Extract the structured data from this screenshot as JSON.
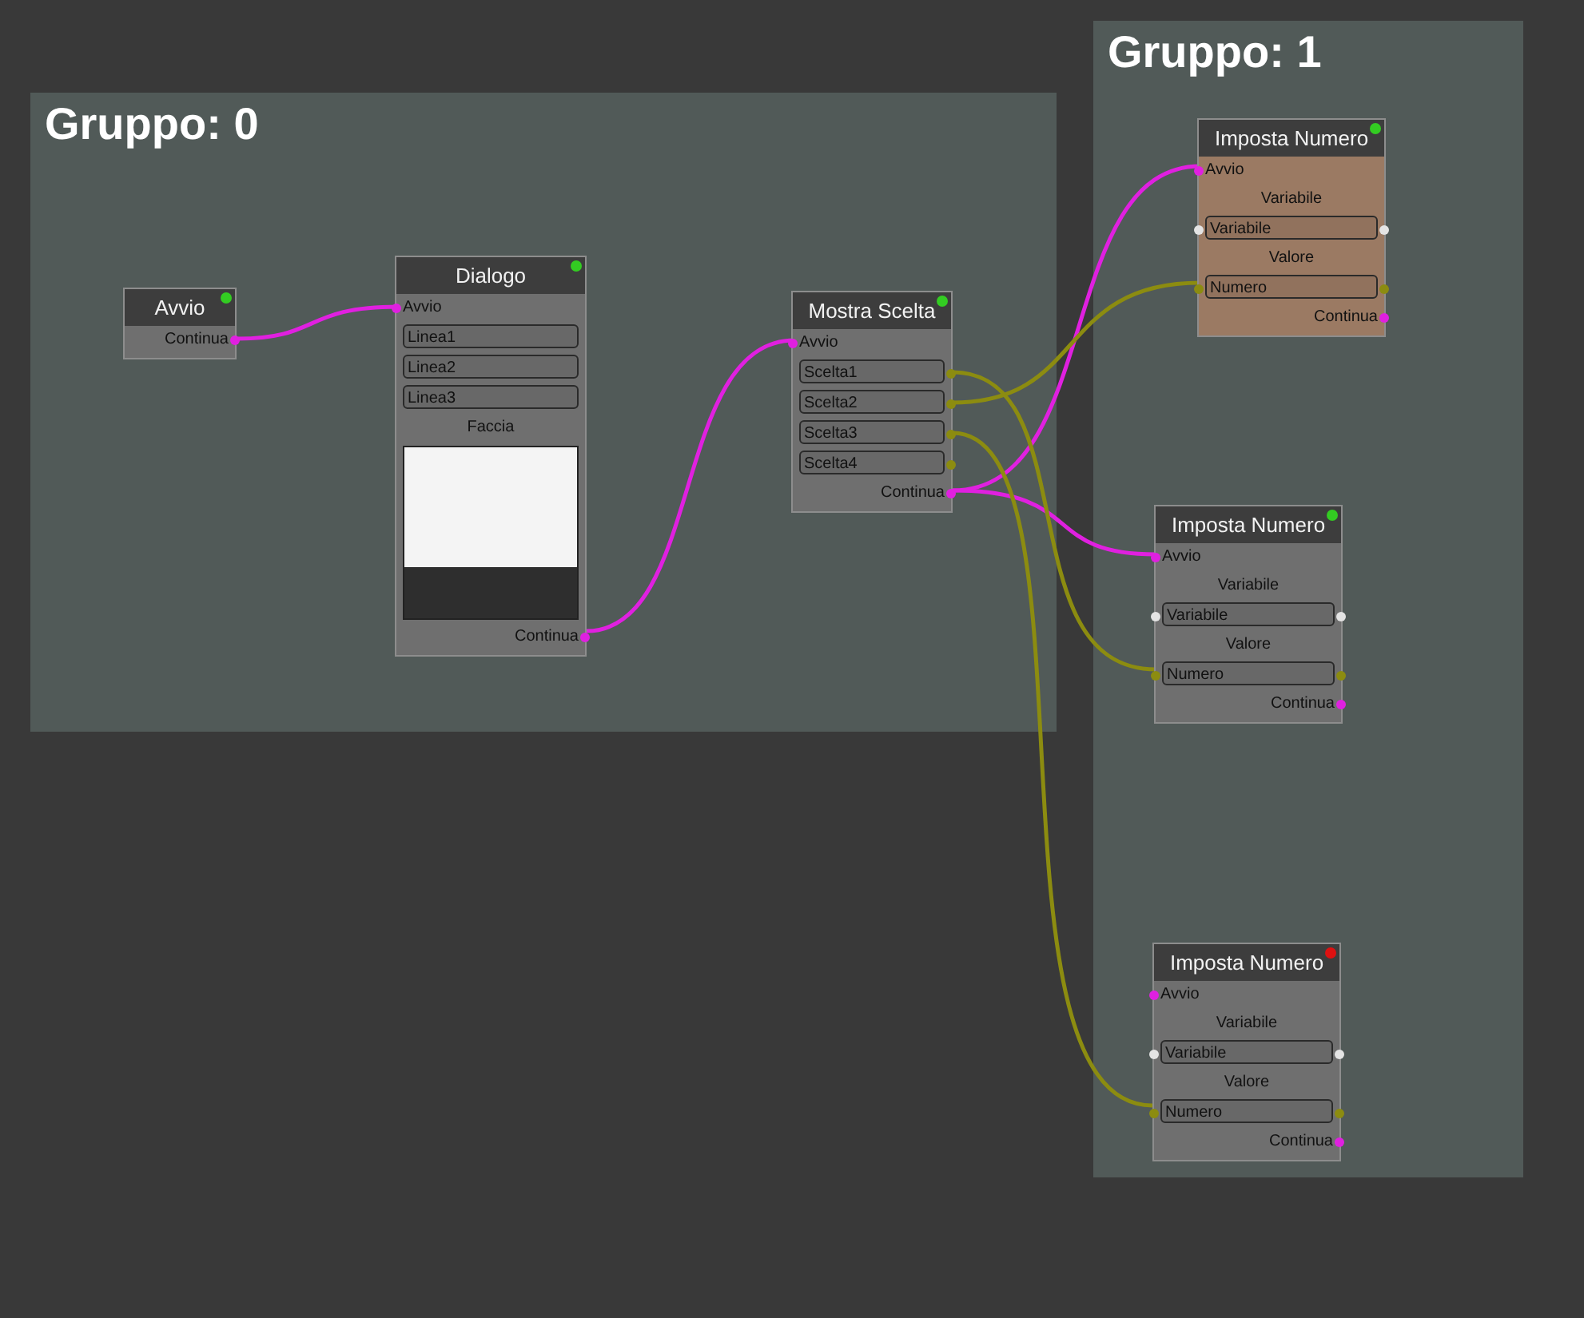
{
  "groups": [
    {
      "title": "Gruppo: 0"
    },
    {
      "title": "Gruppo: 1"
    }
  ],
  "nodes": [
    {
      "title": "Avvio",
      "color": "#33cc22",
      "selected": false,
      "rows": [
        {
          "kind": "output",
          "text": "Continua",
          "out_port": {
            "kind": "exec"
          }
        }
      ]
    },
    {
      "title": "Dialogo",
      "color": "#33cc22",
      "selected": false,
      "rows": [
        {
          "kind": "input",
          "text": "Avvio",
          "in_port": {
            "kind": "exec"
          }
        },
        {
          "kind": "field",
          "text": "Linea1"
        },
        {
          "kind": "field",
          "text": "Linea2"
        },
        {
          "kind": "field",
          "text": "Linea3"
        },
        {
          "kind": "label",
          "text": "Faccia"
        },
        {
          "kind": "portrait"
        },
        {
          "kind": "output",
          "text": "Continua",
          "out_port": {
            "kind": "exec"
          }
        }
      ]
    },
    {
      "title": "Mostra Scelta",
      "color": "#33cc22",
      "selected": false,
      "rows": [
        {
          "kind": "input",
          "text": "Avvio",
          "in_port": {
            "kind": "exec"
          }
        },
        {
          "kind": "field",
          "text": "Scelta1",
          "out_port": {
            "kind": "num"
          }
        },
        {
          "kind": "field",
          "text": "Scelta2",
          "out_port": {
            "kind": "num"
          }
        },
        {
          "kind": "field",
          "text": "Scelta3",
          "out_port": {
            "kind": "num"
          }
        },
        {
          "kind": "field",
          "text": "Scelta4",
          "out_port": {
            "kind": "num"
          }
        },
        {
          "kind": "output",
          "text": "Continua",
          "out_port": {
            "kind": "exec"
          }
        }
      ]
    },
    {
      "title": "Imposta Numero",
      "color": "#33cc22",
      "selected": true,
      "rows": [
        {
          "kind": "input",
          "text": "Avvio",
          "in_port": {
            "kind": "exec"
          }
        },
        {
          "kind": "label",
          "text": "Variabile"
        },
        {
          "kind": "field",
          "text": "Variabile",
          "in_port": {
            "kind": "var"
          },
          "out_port": {
            "kind": "var"
          }
        },
        {
          "kind": "label",
          "text": "Valore"
        },
        {
          "kind": "field",
          "text": "Numero",
          "in_port": {
            "kind": "num"
          },
          "out_port": {
            "kind": "num"
          }
        },
        {
          "kind": "output",
          "text": "Continua",
          "out_port": {
            "kind": "exec"
          }
        }
      ]
    },
    {
      "title": "Imposta Numero",
      "color": "#33cc22",
      "selected": false,
      "rows": [
        {
          "kind": "input",
          "text": "Avvio",
          "in_port": {
            "kind": "exec"
          }
        },
        {
          "kind": "label",
          "text": "Variabile"
        },
        {
          "kind": "field",
          "text": "Variabile",
          "in_port": {
            "kind": "var"
          },
          "out_port": {
            "kind": "var"
          }
        },
        {
          "kind": "label",
          "text": "Valore"
        },
        {
          "kind": "field",
          "text": "Numero",
          "in_port": {
            "kind": "num"
          },
          "out_port": {
            "kind": "num"
          }
        },
        {
          "kind": "output",
          "text": "Continua",
          "out_port": {
            "kind": "exec"
          }
        }
      ]
    },
    {
      "title": "Imposta Numero",
      "color": "#dd1111",
      "selected": false,
      "rows": [
        {
          "kind": "input",
          "text": "Avvio",
          "in_port": {
            "kind": "exec"
          }
        },
        {
          "kind": "label",
          "text": "Variabile"
        },
        {
          "kind": "field",
          "text": "Variabile",
          "in_port": {
            "kind": "var"
          },
          "out_port": {
            "kind": "var"
          }
        },
        {
          "kind": "label",
          "text": "Valore"
        },
        {
          "kind": "field",
          "text": "Numero",
          "in_port": {
            "kind": "num"
          },
          "out_port": {
            "kind": "num"
          }
        },
        {
          "kind": "output",
          "text": "Continua",
          "out_port": {
            "kind": "exec"
          }
        }
      ]
    }
  ]
}
